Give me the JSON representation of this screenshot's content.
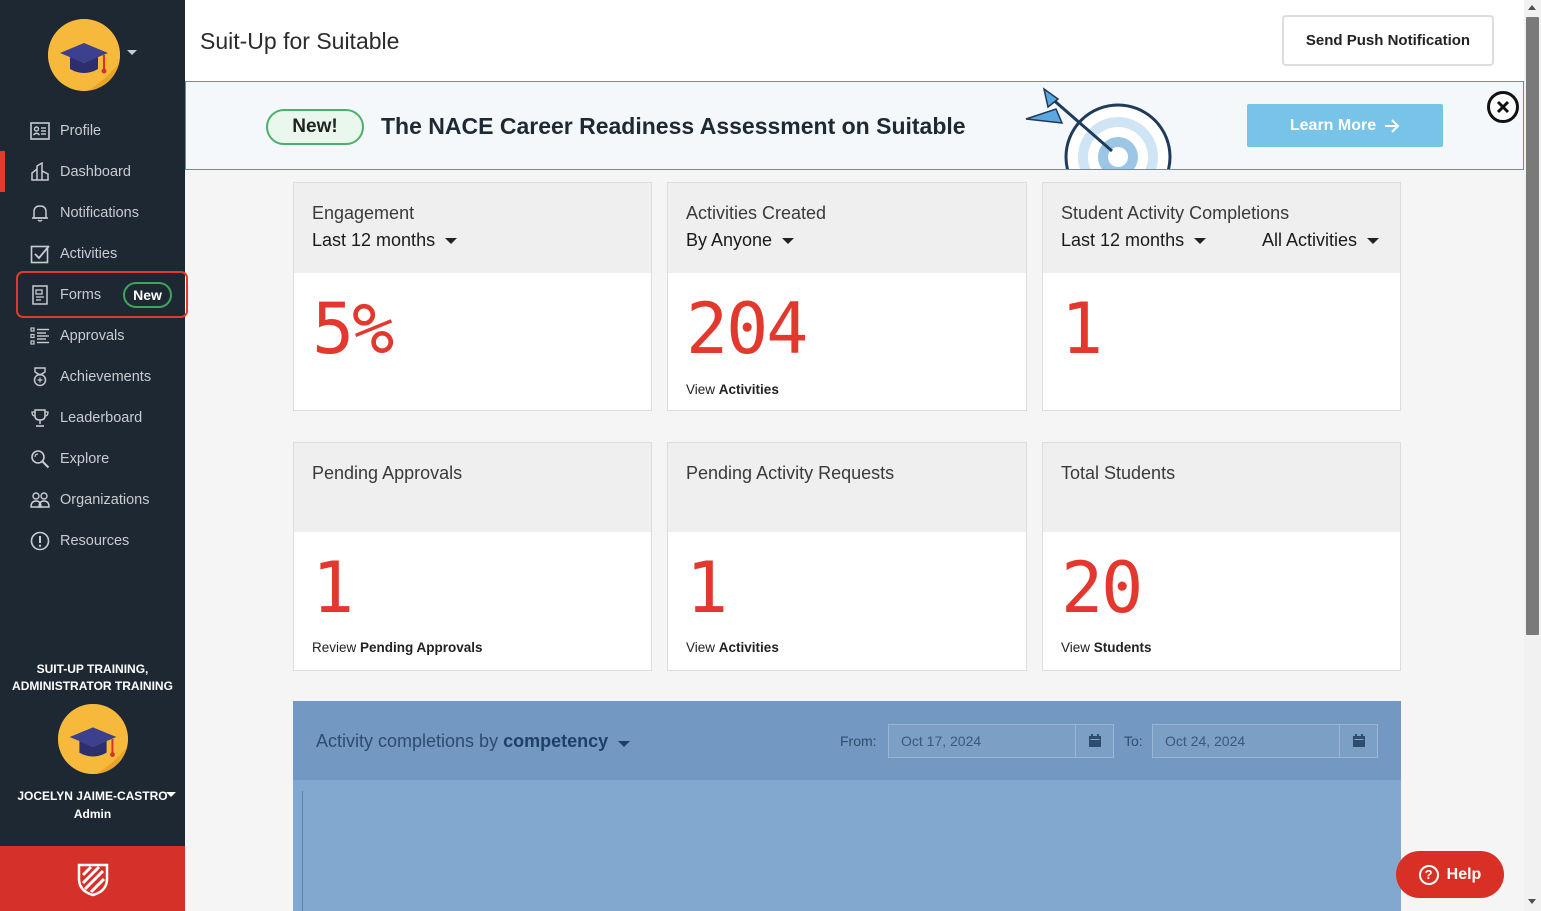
{
  "sidebar": {
    "items": [
      {
        "label": "Profile",
        "icon": "profile-card-icon"
      },
      {
        "label": "Dashboard",
        "icon": "dashboard-icon"
      },
      {
        "label": "Notifications",
        "icon": "bell-icon"
      },
      {
        "label": "Activities",
        "icon": "checkbox-icon"
      },
      {
        "label": "Forms",
        "icon": "form-icon",
        "badge": "New"
      },
      {
        "label": "Approvals",
        "icon": "list-check-icon"
      },
      {
        "label": "Achievements",
        "icon": "medal-icon"
      },
      {
        "label": "Leaderboard",
        "icon": "trophy-icon"
      },
      {
        "label": "Explore",
        "icon": "search-icon"
      },
      {
        "label": "Organizations",
        "icon": "people-icon"
      },
      {
        "label": "Resources",
        "icon": "info-icon"
      }
    ],
    "org_line1": "SUIT-UP TRAINING,",
    "org_line2": "ADMINISTRATOR TRAINING",
    "user_name": "JOCELYN JAIME-CASTRO",
    "user_role": "Admin"
  },
  "header": {
    "title": "Suit-Up for Suitable",
    "push_button": "Send Push Notification"
  },
  "banner": {
    "badge": "New!",
    "text": "The NACE Career Readiness Assessment on Suitable",
    "cta": "Learn More"
  },
  "cards": {
    "engagement": {
      "title": "Engagement",
      "filter": "Last 12 months",
      "value": "5%"
    },
    "activities_created": {
      "title": "Activities Created",
      "filter": "By Anyone",
      "value": "204",
      "link_prefix": "View",
      "link_bold": "Activities"
    },
    "completions": {
      "title": "Student Activity Completions",
      "filter": "Last 12 months",
      "filter2": "All Activities",
      "value": "1"
    },
    "pending_approvals": {
      "title": "Pending Approvals",
      "value": "1",
      "link_prefix": "Review",
      "link_bold": "Pending Approvals"
    },
    "pending_requests": {
      "title": "Pending Activity Requests",
      "value": "1",
      "link_prefix": "View",
      "link_bold": "Activities"
    },
    "total_students": {
      "title": "Total Students",
      "value": "20",
      "link_prefix": "View",
      "link_bold": "Students"
    }
  },
  "chart_panel": {
    "title_prefix": "Activity completions by",
    "title_select": "competency",
    "from_label": "From:",
    "from_value": "Oct 17, 2024",
    "to_label": "To:",
    "to_value": "Oct 24, 2024"
  },
  "help": {
    "label": "Help"
  },
  "colors": {
    "accent": "#e2382e",
    "sidebar": "#1e2833",
    "panel": "#83a8cf",
    "learn_more": "#78c4e8"
  }
}
